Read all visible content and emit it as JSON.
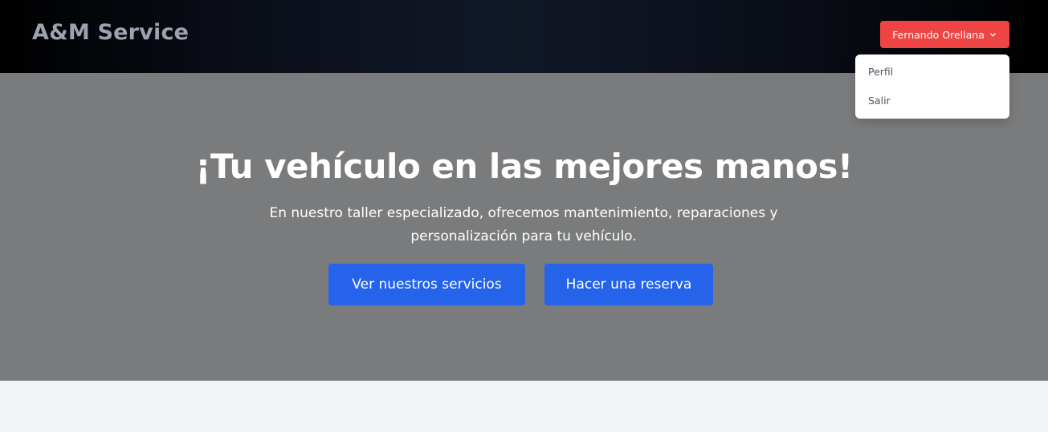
{
  "header": {
    "brand": "A&M Service",
    "user_button_label": "Fernando Orellana",
    "user_button_icon": "chevron-down-icon",
    "colors": {
      "user_button": "#ef4444"
    }
  },
  "user_menu": {
    "items": [
      {
        "label": "Perfil"
      },
      {
        "label": "Salir"
      }
    ]
  },
  "hero": {
    "title": "¡Tu vehículo en las mejores manos!",
    "subtitle_line1": "En nuestro taller especializado, ofrecemos mantenimiento, reparaciones y",
    "subtitle_line2": "personalización para tu vehículo.",
    "buttons": [
      {
        "label": "Ver nuestros servicios"
      },
      {
        "label": "Hacer una reserva"
      }
    ],
    "colors": {
      "background": "#7a7b7c",
      "button": "#2563eb"
    }
  }
}
